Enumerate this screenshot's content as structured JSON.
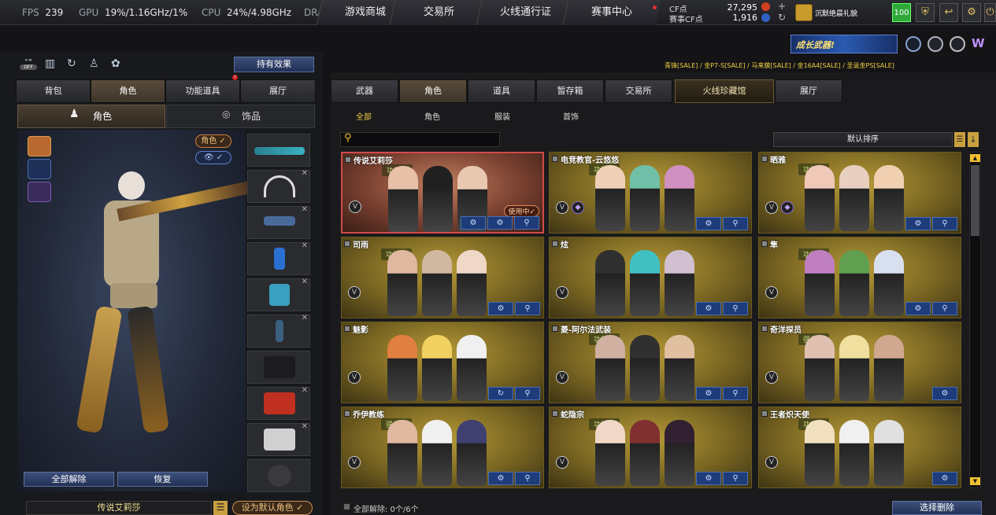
{
  "stats": {
    "fps_label": "FPS",
    "fps": "239",
    "gpu_label": "GPU",
    "gpu": "19%/1.16GHz/1%",
    "cpu_label": "CPU",
    "cpu": "24%/4.98GHz",
    "dram_label": "DRAM"
  },
  "nav": [
    "游戏商城",
    "交易所",
    "火线通行证",
    "赛事中心"
  ],
  "currency": {
    "cf_label": "CF点",
    "cf_value": "27,295",
    "match_label": "赛事CF点",
    "match_value": "1,916"
  },
  "user": {
    "name": "沉默绝晨礼貌",
    "level": "100"
  },
  "banner": "成长武器!",
  "sale_text": "青锋[SALE] / 金P7-S[SALE] / 马来貘[SALE] / 金16A4[SALE] / 圣诞金PS[SALE]",
  "left": {
    "hold_effect": "持有效果",
    "tabs": [
      "背包",
      "角色",
      "功能道具",
      "展厅"
    ],
    "subtabs": [
      "角色",
      "饰品"
    ],
    "badge_role": "角色 ✓",
    "badge_eye": "👁 ✓",
    "btn_unequip": "全部解除",
    "btn_restore": "恢复",
    "char_name": "传说艾莉莎",
    "btn_default": "设为默认角色 ✓",
    "off_label": "OFF"
  },
  "right": {
    "tabs": [
      "武器",
      "角色",
      "道具",
      "暂存箱",
      "交易所",
      "火线珍藏馆",
      "展厅"
    ],
    "subtabs": [
      "全部",
      "角色",
      "服装",
      "首饰"
    ],
    "sort": "默认排序",
    "footer": "全部解除: 0个/6个",
    "btn_select_delete": "选择删除"
  },
  "cards": [
    {
      "name": "传说艾莉莎",
      "type": "功能型",
      "in_use": "使用中✓"
    },
    {
      "name": "电竞教官-云悠悠",
      "type": "功能型"
    },
    {
      "name": "晒雅",
      "type": "功能型"
    },
    {
      "name": "司雨",
      "type": "功能型"
    },
    {
      "name": "炫",
      "type": ""
    },
    {
      "name": "隼",
      "type": "功能型"
    },
    {
      "name": "魅影",
      "type": ""
    },
    {
      "name": "菱-阿尔法武装",
      "type": "功能型"
    },
    {
      "name": "奇洋探员",
      "type": "强化型"
    },
    {
      "name": "乔伊教练",
      "type": "强化型"
    },
    {
      "name": "蛇隐宗",
      "type": "功能型"
    },
    {
      "name": "王者炽天使",
      "type": "功能型"
    }
  ]
}
